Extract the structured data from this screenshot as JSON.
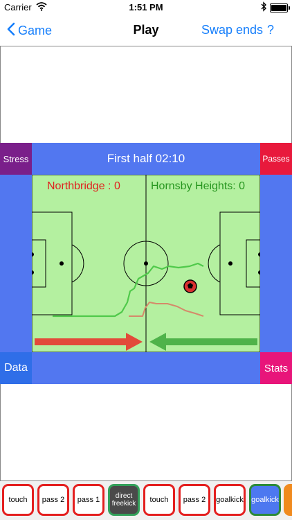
{
  "status_bar": {
    "carrier": "Carrier",
    "time": "1:51 PM"
  },
  "nav": {
    "back_label": "Game",
    "title": "Play",
    "swap_label": "Swap ends",
    "help_label": "?"
  },
  "match": {
    "period_clock": "First half 02:10",
    "home_score": "Northbridge : 0",
    "away_score": "Hornsby Heights: 0"
  },
  "corners": {
    "stress": "Stress",
    "passes": "Passes",
    "data": "Data",
    "stats": "Stats"
  },
  "colors": {
    "accent": "#157efb",
    "band": "#5277f0",
    "pitch": "#b4f0a0",
    "home": "#e0211e",
    "away": "#27961f",
    "stress": "#7a1f8a",
    "passes": "#e8193c",
    "data": "#2f6ee8",
    "stats": "#e8157a"
  },
  "toolbar": {
    "buttons": [
      "touch",
      "pass 2",
      "pass 1",
      "direct freekick",
      "touch",
      "pass 2",
      "goalkick",
      "goalkick"
    ]
  }
}
